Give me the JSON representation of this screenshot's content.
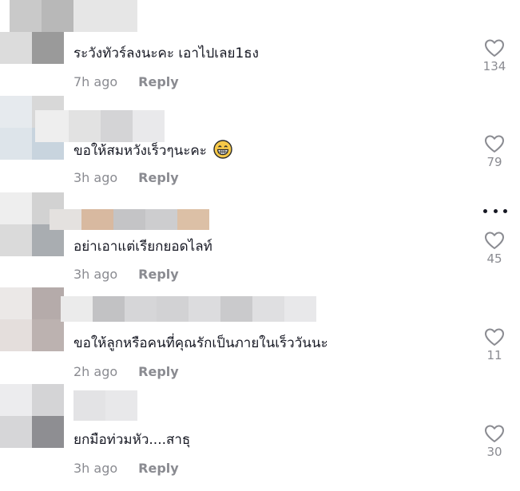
{
  "comments": [
    {
      "text": "ระวังทัวร์ลงนะคะ เอาไปเลย1ธง",
      "time": "7h ago",
      "reply": "Reply",
      "likes": "134"
    },
    {
      "text": "ขอให้สมหวังเร็วๆนะคะ",
      "emoji": "grinning-face-emoji",
      "time": "3h ago",
      "reply": "Reply",
      "likes": "79"
    },
    {
      "text": "อย่าเอาแต่เรียกยอดไลท์",
      "time": "3h ago",
      "reply": "Reply",
      "likes": "45"
    },
    {
      "text": "ขอให้ลูกหรือคนที่คุณรักเป็นภายในเร็ววันนะ",
      "time": "2h ago",
      "reply": "Reply",
      "likes": "11"
    },
    {
      "text": "ยกมือท่วมหัว....สาธุ",
      "time": "3h ago",
      "reply": "Reply",
      "likes": "30"
    }
  ],
  "icons": {
    "like": "heart-outline-icon",
    "more": "more-dots-icon"
  },
  "colors": {
    "text": "#161823",
    "muted": "#8a8b91",
    "background": "#ffffff"
  }
}
